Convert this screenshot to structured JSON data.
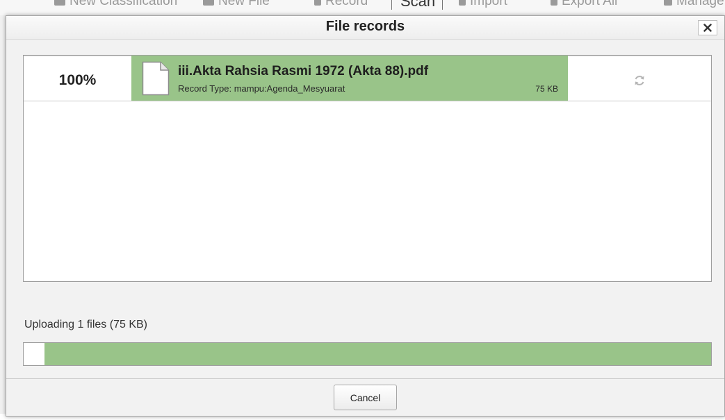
{
  "background_toolbar": {
    "items": [
      {
        "label": "New Classification",
        "icon": "folder-icon"
      },
      {
        "label": "New File",
        "icon": "folder-icon"
      },
      {
        "label": "Record",
        "icon": "upload-icon"
      },
      {
        "label": "Scan",
        "icon": ""
      },
      {
        "label": "Import",
        "icon": "import-icon"
      },
      {
        "label": "Export All",
        "icon": "export-icon"
      },
      {
        "label": "Manage",
        "icon": "lock-icon"
      }
    ]
  },
  "dialog": {
    "title": "File records",
    "close_icon": "close-icon",
    "files": [
      {
        "percent": "100%",
        "name": "iii.Akta Rahsia Rasmi 1972 (Akta 88).pdf",
        "record_type": "Record Type: mampu:Agenda_Mesyuarat",
        "size": "75 KB",
        "icon": "document-icon",
        "action_icon": "refresh-icon"
      }
    ],
    "upload_status": "Uploading 1 files (75 KB)",
    "progress_fraction": 0.97,
    "cancel_label": "Cancel",
    "colors": {
      "accent_green": "#99c489",
      "border": "#9e9e9e",
      "dialog_bg": "#f2f2f2"
    }
  }
}
